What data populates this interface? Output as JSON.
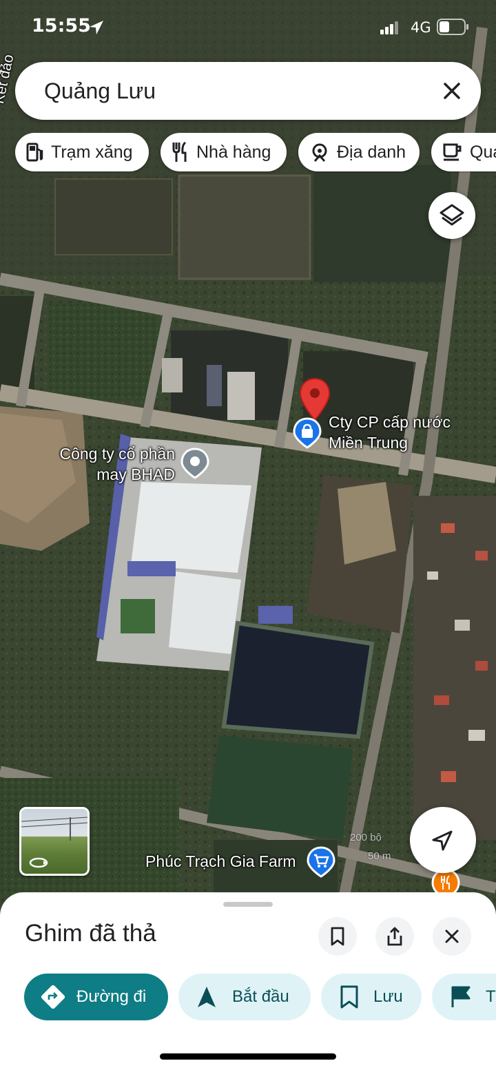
{
  "status_bar": {
    "time": "15:55",
    "network": "4G"
  },
  "search": {
    "value": "Quảng Lưu"
  },
  "chips": [
    {
      "label": "Trạm xăng",
      "icon": "gas-station-icon"
    },
    {
      "label": "Nhà hàng",
      "icon": "restaurant-icon"
    },
    {
      "label": "Địa danh",
      "icon": "landmark-icon"
    },
    {
      "label": "Quá",
      "icon": "coffee-icon"
    }
  ],
  "map": {
    "road_label_partial": "Kết đảo",
    "places": [
      {
        "name_line1": "Cty CP cấp nước",
        "name_line2": "Miền Trung"
      },
      {
        "name_line1": "Công ty cổ phần",
        "name_line2": "may BHAD"
      },
      {
        "name_line1": "Phúc Trạch Gia Farm"
      }
    ],
    "scale": {
      "top": "200 bộ",
      "bottom": "50 m"
    }
  },
  "sheet": {
    "title": "Ghim đã thả",
    "actions": [
      {
        "label": "Đường đi",
        "icon": "directions-icon",
        "primary": true
      },
      {
        "label": "Bắt đầu",
        "icon": "navigation-arrow-icon"
      },
      {
        "label": "Lưu",
        "icon": "bookmark-icon"
      },
      {
        "label": "T",
        "icon": "flag-icon"
      }
    ]
  },
  "colors": {
    "accent": "#0e7d85",
    "chip_bg": "#dff3f7",
    "pin_red": "#e53935",
    "poi_blue": "#1a73e8",
    "poi_orange": "#f57c00"
  }
}
